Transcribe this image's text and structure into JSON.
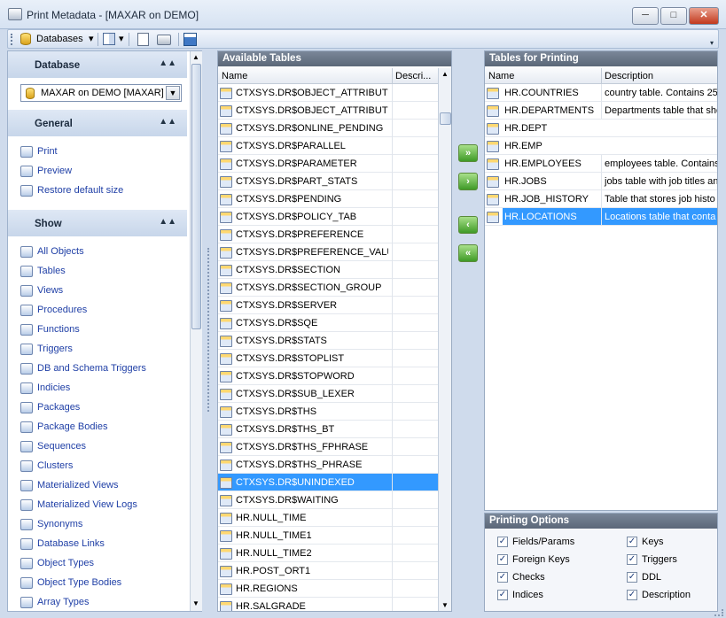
{
  "window": {
    "title": "Print Metadata - [MAXAR on DEMO]",
    "buttons": {
      "minimize": "─",
      "maximize": "□",
      "close": "✕"
    }
  },
  "toolbar": {
    "databases_label": "Databases",
    "dropdown_glyph": "▾"
  },
  "left": {
    "database": {
      "header": "Database",
      "selected": "MAXAR on DEMO [MAXAR]"
    },
    "general": {
      "header": "General",
      "items": [
        "Print",
        "Preview",
        "Restore default size"
      ]
    },
    "show": {
      "header": "Show",
      "items": [
        "All Objects",
        "Tables",
        "Views",
        "Procedures",
        "Functions",
        "Triggers",
        "DB and Schema Triggers",
        "Indicies",
        "Packages",
        "Package Bodies",
        "Sequences",
        "Clusters",
        "Materialized Views",
        "Materialized View Logs",
        "Synonyms",
        "Database Links",
        "Object Types",
        "Object Type Bodies",
        "Array Types"
      ]
    }
  },
  "available": {
    "header": "Available Tables",
    "col_name": "Name",
    "col_desc": "Descri...",
    "rows": [
      "CTXSYS.DR$OBJECT_ATTRIBUT",
      "CTXSYS.DR$OBJECT_ATTRIBUT",
      "CTXSYS.DR$ONLINE_PENDING",
      "CTXSYS.DR$PARALLEL",
      "CTXSYS.DR$PARAMETER",
      "CTXSYS.DR$PART_STATS",
      "CTXSYS.DR$PENDING",
      "CTXSYS.DR$POLICY_TAB",
      "CTXSYS.DR$PREFERENCE",
      "CTXSYS.DR$PREFERENCE_VALU",
      "CTXSYS.DR$SECTION",
      "CTXSYS.DR$SECTION_GROUP",
      "CTXSYS.DR$SERVER",
      "CTXSYS.DR$SQE",
      "CTXSYS.DR$STATS",
      "CTXSYS.DR$STOPLIST",
      "CTXSYS.DR$STOPWORD",
      "CTXSYS.DR$SUB_LEXER",
      "CTXSYS.DR$THS",
      "CTXSYS.DR$THS_BT",
      "CTXSYS.DR$THS_FPHRASE",
      "CTXSYS.DR$THS_PHRASE",
      "CTXSYS.DR$UNINDEXED",
      "CTXSYS.DR$WAITING",
      "HR.NULL_TIME",
      "HR.NULL_TIME1",
      "HR.NULL_TIME2",
      "HR.POST_ORT1",
      "HR.REGIONS",
      "HR.SALGRADE"
    ],
    "selected_index": 22
  },
  "transfer": {
    "add_all": "»",
    "add": "›",
    "remove": "‹",
    "remove_all": "«"
  },
  "printing": {
    "header": "Tables for Printing",
    "col_name": "Name",
    "col_desc": "Description",
    "rows": [
      {
        "name": "HR.COUNTRIES",
        "desc": "country table. Contains 25"
      },
      {
        "name": "HR.DEPARTMENTS",
        "desc": "Departments table that sho"
      },
      {
        "name": "HR.DEPT",
        "desc": ""
      },
      {
        "name": "HR.EMP",
        "desc": ""
      },
      {
        "name": "HR.EMPLOYEES",
        "desc": "employees table. Contains"
      },
      {
        "name": "HR.JOBS",
        "desc": "jobs table with job titles an"
      },
      {
        "name": "HR.JOB_HISTORY",
        "desc": "Table that stores job histo"
      },
      {
        "name": "HR.LOCATIONS",
        "desc": "Locations table that conta"
      }
    ],
    "selected_index": 7
  },
  "options": {
    "header": "Printing Options",
    "items": [
      {
        "label": "Fields/Params",
        "checked": true
      },
      {
        "label": "Keys",
        "checked": true
      },
      {
        "label": "Foreign Keys",
        "checked": true
      },
      {
        "label": "Triggers",
        "checked": true
      },
      {
        "label": "Checks",
        "checked": true
      },
      {
        "label": "DDL",
        "checked": true
      },
      {
        "label": "Indices",
        "checked": true
      },
      {
        "label": "Description",
        "checked": true
      }
    ]
  }
}
